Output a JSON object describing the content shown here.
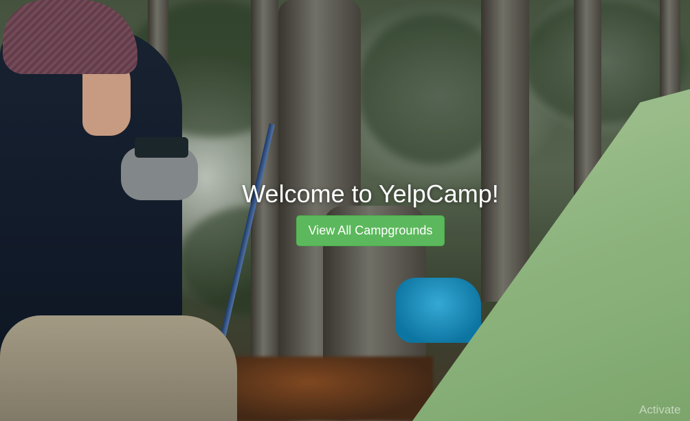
{
  "hero": {
    "title": "Welcome to YelpCamp!",
    "cta_label": "View All Campgrounds"
  },
  "watermark": {
    "text": "Activate"
  },
  "colors": {
    "cta_background": "#5cb85c",
    "cta_text": "#ffffff",
    "title_text": "#ffffff"
  },
  "background_image": {
    "subject": "camper-in-forest-with-tent"
  }
}
